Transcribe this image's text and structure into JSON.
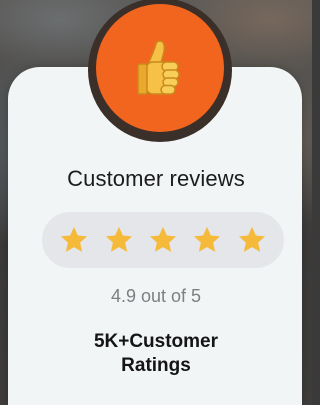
{
  "badge": {
    "icon": "thumbs-up-icon",
    "color": "#f2651e"
  },
  "review_card": {
    "title": "Customer reviews",
    "stars": {
      "filled": 5,
      "total": 5,
      "color": "#f6ba3a"
    },
    "rating_text": "4.9 out of 5",
    "ratings_count_line1": "5K+Customer",
    "ratings_count_line2": "Ratings"
  }
}
